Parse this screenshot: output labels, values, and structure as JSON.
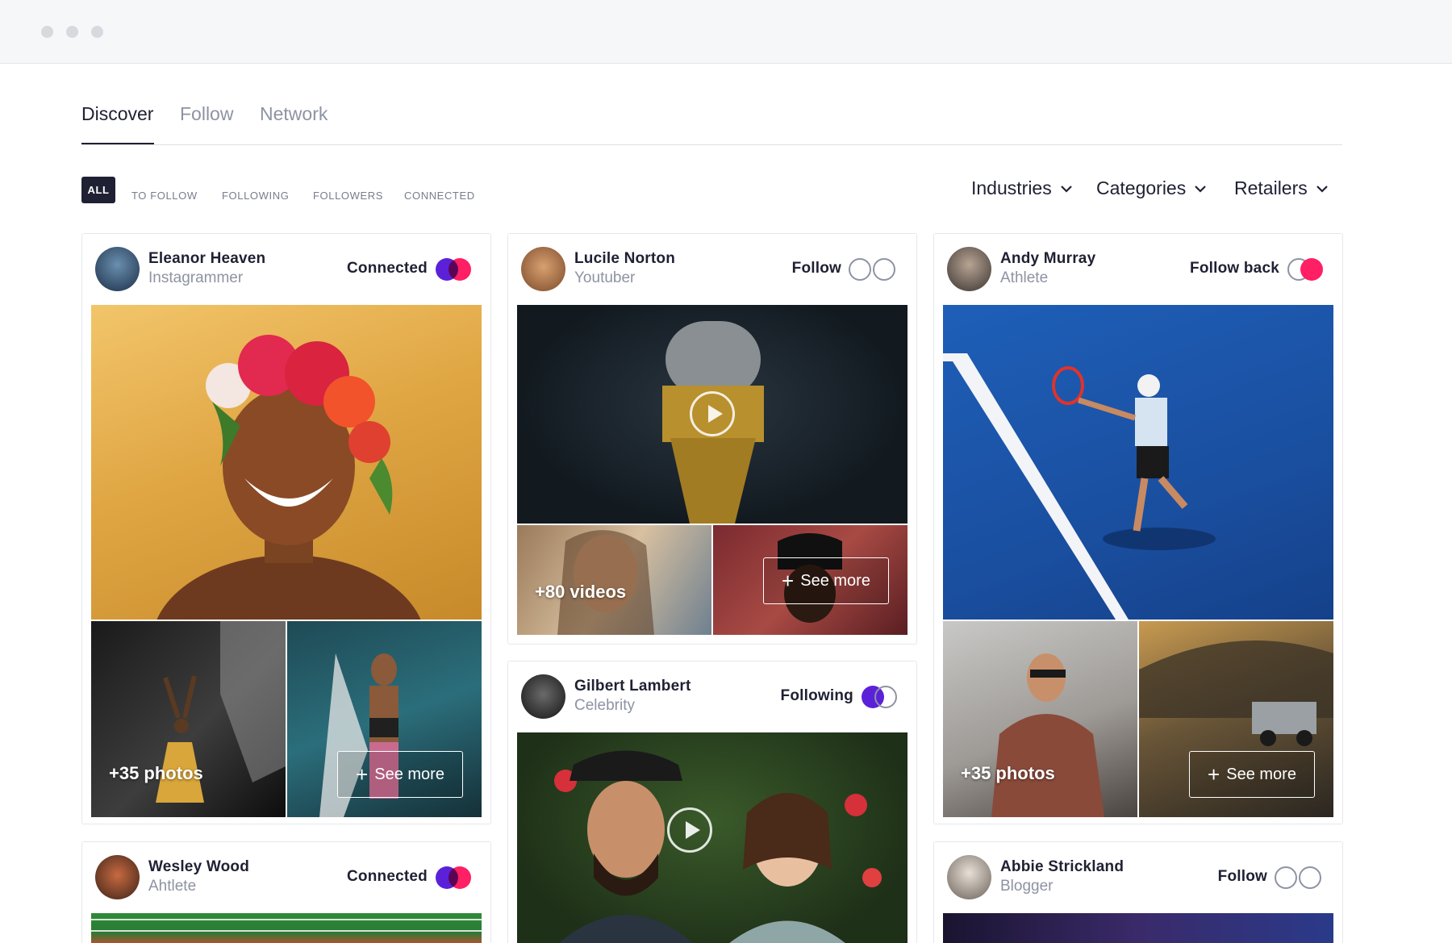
{
  "tabs": [
    {
      "label": "Discover",
      "active": true
    },
    {
      "label": "Follow",
      "active": false
    },
    {
      "label": "Network",
      "active": false
    }
  ],
  "filters": [
    "ALL",
    "TO FOLLOW",
    "FOLLOWING",
    "FOLLOWERS",
    "CONNECTED"
  ],
  "dropdowns": [
    "Industries",
    "Categories",
    "Retailers"
  ],
  "colors": {
    "purple": "#5b21d9",
    "pink": "#ff1f64",
    "dark": "#1f2033",
    "muted": "#8e93a3"
  },
  "cards": [
    {
      "name": "Eleanor Heaven",
      "role": "Instagrammer",
      "status": "Connected",
      "toggle": "connected",
      "count_label": "+35 photos",
      "cta": "See more"
    },
    {
      "name": "Lucile Norton",
      "role": "Youtuber",
      "status": "Follow",
      "toggle": "off",
      "count_label": "+80 videos",
      "cta": "See more"
    },
    {
      "name": "Andy Murray",
      "role": "Athlete",
      "status": "Follow back",
      "toggle": "follow-back",
      "count_label": "+35 photos",
      "cta": "See more"
    },
    {
      "name": "Gilbert Lambert",
      "role": "Celebrity",
      "status": "Following",
      "toggle": "following"
    },
    {
      "name": "Wesley Wood",
      "role": "Ahtlete",
      "status": "Connected",
      "toggle": "connected"
    },
    {
      "name": "Abbie Strickland",
      "role": "Blogger",
      "status": "Follow",
      "toggle": "off"
    }
  ]
}
